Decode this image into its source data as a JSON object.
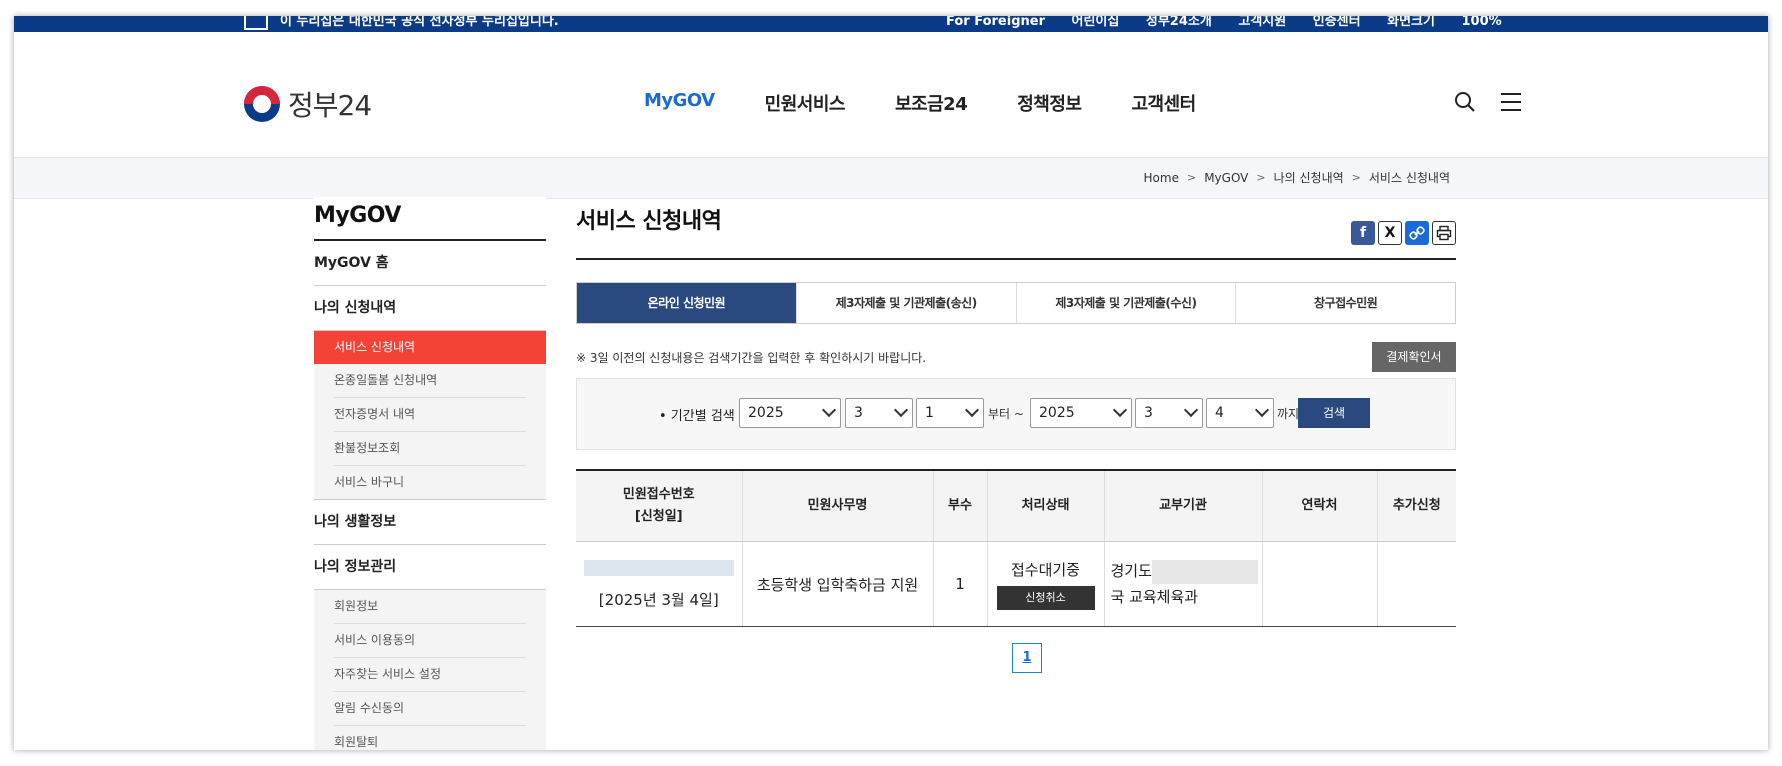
{
  "topbar": {
    "notice": "이 누리집은 대한민국 공식 전자정부 누리집입니다.",
    "utils": [
      "For Foreigner",
      "어린이집",
      "정부24소개",
      "고객지원",
      "인증센터",
      "화면크기",
      "100%"
    ]
  },
  "header": {
    "logo_text": "정부24",
    "nav": [
      "MyGOV",
      "민원서비스",
      "보조금24",
      "정책정보",
      "고객센터"
    ]
  },
  "breadcrumb": [
    "Home",
    "MyGOV",
    "나의 신청내역",
    "서비스 신청내역"
  ],
  "lnb": {
    "title": "MyGOV",
    "home": "MyGOV 홈",
    "section1": "나의 신청내역",
    "sub1": [
      "서비스 신청내역",
      "온종일돌봄 신청내역",
      "전자증명서 내역",
      "환불정보조회",
      "서비스 바구니"
    ],
    "section2": "나의 생활정보",
    "section3": "나의 정보관리",
    "sub3": [
      "회원정보",
      "서비스 이용동의",
      "자주찾는 서비스 설정",
      "알림 수신동의",
      "회원탈퇴"
    ]
  },
  "content": {
    "title": "서비스 신청내역",
    "tabs": [
      "온라인 신청민원",
      "제3자제출 및 기관제출(송신)",
      "제3자제출 및 기관제출(수신)",
      "창구접수민원"
    ],
    "notice": "※ 3일 이전의 신청내용은 검색기간을 입력한 후 확인하시기 바랍니다.",
    "receipt_button": "결제확인서",
    "search": {
      "label": "• 기간별 검색",
      "from_year": "2025",
      "from_month": "3",
      "from_day": "1",
      "from_word": "부터 ~",
      "to_year": "2025",
      "to_month": "3",
      "to_day": "4",
      "to_word": "까지",
      "button": "검색"
    },
    "table": {
      "headers": {
        "receipt_no": "민원접수번호",
        "receipt_date_label": "[신청일]",
        "service_name": "민원사무명",
        "copies": "부수",
        "status": "처리상태",
        "issuer": "교부기관",
        "contact": "연락처",
        "extra": "추가신청"
      },
      "rows": [
        {
          "date": "[2025년 3월 4일]",
          "service_name": "초등학생 입학축하금 지원",
          "copies": "1",
          "status": "접수대기중",
          "cancel": "신청취소",
          "issuer_line1": "경기도",
          "issuer_line2": "국 교육체육과"
        }
      ]
    },
    "page": "1"
  },
  "colors": {
    "primary_navy": "#0b3a86",
    "tab_active": "#2a4a7f",
    "nav_active": "#1b6bd6",
    "menu_current": "#f44336"
  }
}
